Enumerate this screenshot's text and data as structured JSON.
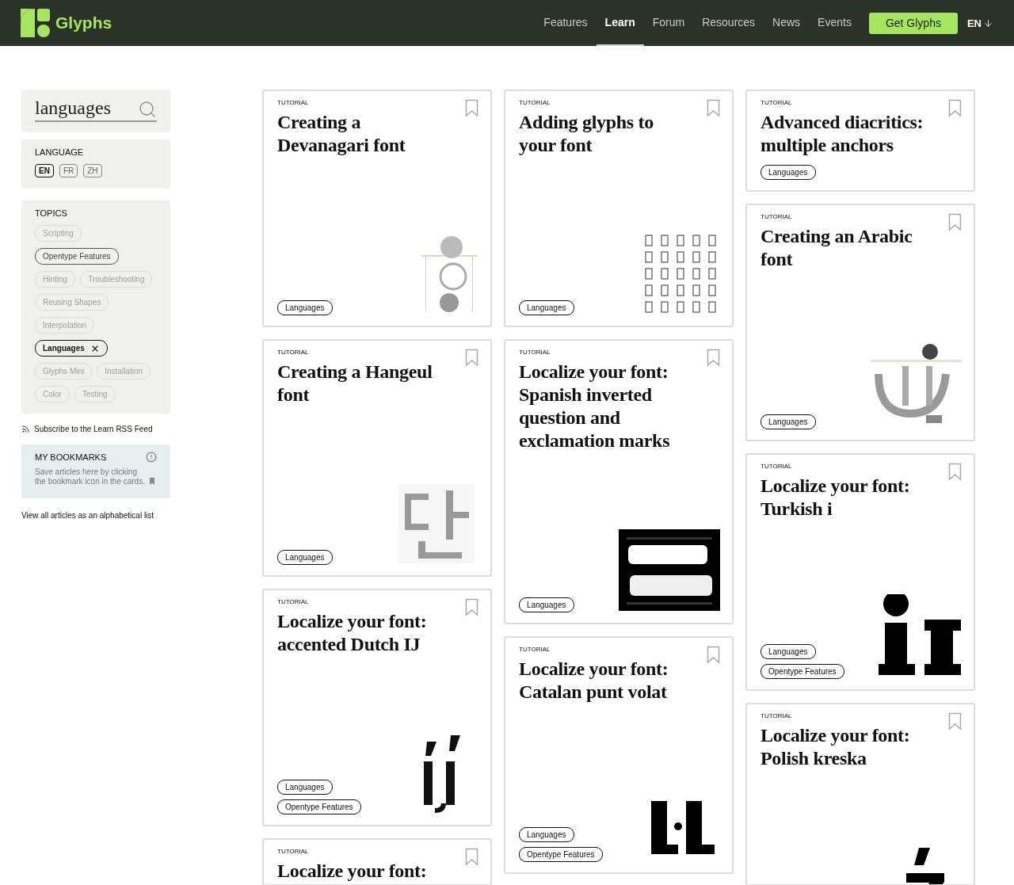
{
  "header": {
    "logo_text": "Glyphs",
    "nav": [
      {
        "label": "Features",
        "selected": false
      },
      {
        "label": "Learn",
        "selected": true
      },
      {
        "label": "Forum",
        "selected": false
      },
      {
        "label": "Resources",
        "selected": false
      },
      {
        "label": "News",
        "selected": false
      },
      {
        "label": "Events",
        "selected": false
      }
    ],
    "cta": "Get Glyphs",
    "language": "EN"
  },
  "sidebar": {
    "search": {
      "value": "languages"
    },
    "language": {
      "title": "LANGUAGE",
      "options": [
        {
          "label": "EN",
          "selected": true
        },
        {
          "label": "FR",
          "selected": false
        },
        {
          "label": "ZH",
          "selected": false
        }
      ]
    },
    "topics": {
      "title": "TOPICS",
      "items": [
        {
          "label": "Scripting",
          "disabled": true,
          "selected": false
        },
        {
          "label": "Opentype Features",
          "disabled": false,
          "selected": false
        },
        {
          "label": "Hinting",
          "disabled": true,
          "selected": false
        },
        {
          "label": "Troubleshooting",
          "disabled": true,
          "selected": false
        },
        {
          "label": "Reusing Shapes",
          "disabled": true,
          "selected": false
        },
        {
          "label": "Interpolation",
          "disabled": true,
          "selected": false
        },
        {
          "label": "Languages",
          "disabled": false,
          "selected": true
        },
        {
          "label": "Glyphs Mini",
          "disabled": true,
          "selected": false
        },
        {
          "label": "Installation",
          "disabled": true,
          "selected": false
        },
        {
          "label": "Color",
          "disabled": true,
          "selected": false
        },
        {
          "label": "Testing",
          "disabled": true,
          "selected": false
        }
      ]
    },
    "rss": "Subscribe to the Learn RSS Feed",
    "bookmarks": {
      "title": "MY BOOKMARKS",
      "text": "Save articles here by clicking the bookmark icon in the cards."
    },
    "all_articles": "View all articles as an alphabetical list"
  },
  "columns": [
    [
      {
        "label": "TUTORIAL",
        "title": "Creating a Devanagari font",
        "tags": [
          "Languages"
        ],
        "illustrated": true
      },
      {
        "label": "TUTORIAL",
        "title": "Creating a Hangeul font",
        "tags": [
          "Languages"
        ],
        "illustrated": true
      },
      {
        "label": "TUTORIAL",
        "title": "Localize your font: accented Dutch IJ",
        "tags": [
          "Languages",
          "Opentype Features"
        ],
        "illustrated": true
      },
      {
        "label": "TUTORIAL",
        "title": "Localize your font:",
        "illustrated": false
      }
    ],
    [
      {
        "label": "TUTORIAL",
        "title": "Adding glyphs to your font",
        "tags": [
          "Languages"
        ],
        "illustrated": true
      },
      {
        "label": "TUTORIAL",
        "title": "Localize your font: Spanish inverted question and exclamation marks",
        "tags": [
          "Languages"
        ],
        "illustrated": true
      },
      {
        "label": "TUTORIAL",
        "title": "Localize your font: Catalan punt volat",
        "tags": [
          "Languages",
          "Opentype Features"
        ],
        "illustrated": true
      }
    ],
    [
      {
        "label": "TUTORIAL",
        "title": "Advanced diacritics: multiple anchors",
        "tags": [
          "Languages"
        ],
        "illustrated": false
      },
      {
        "label": "TUTORIAL",
        "title": "Creating an Arabic font",
        "tags": [
          "Languages"
        ],
        "illustrated": true
      },
      {
        "label": "TUTORIAL",
        "title": "Localize your font: Turkish i",
        "tags": [
          "Languages",
          "Opentype Features"
        ],
        "illustrated": true
      },
      {
        "label": "TUTORIAL",
        "title": "Localize your font: Polish kreska",
        "illustrated": true
      }
    ]
  ]
}
